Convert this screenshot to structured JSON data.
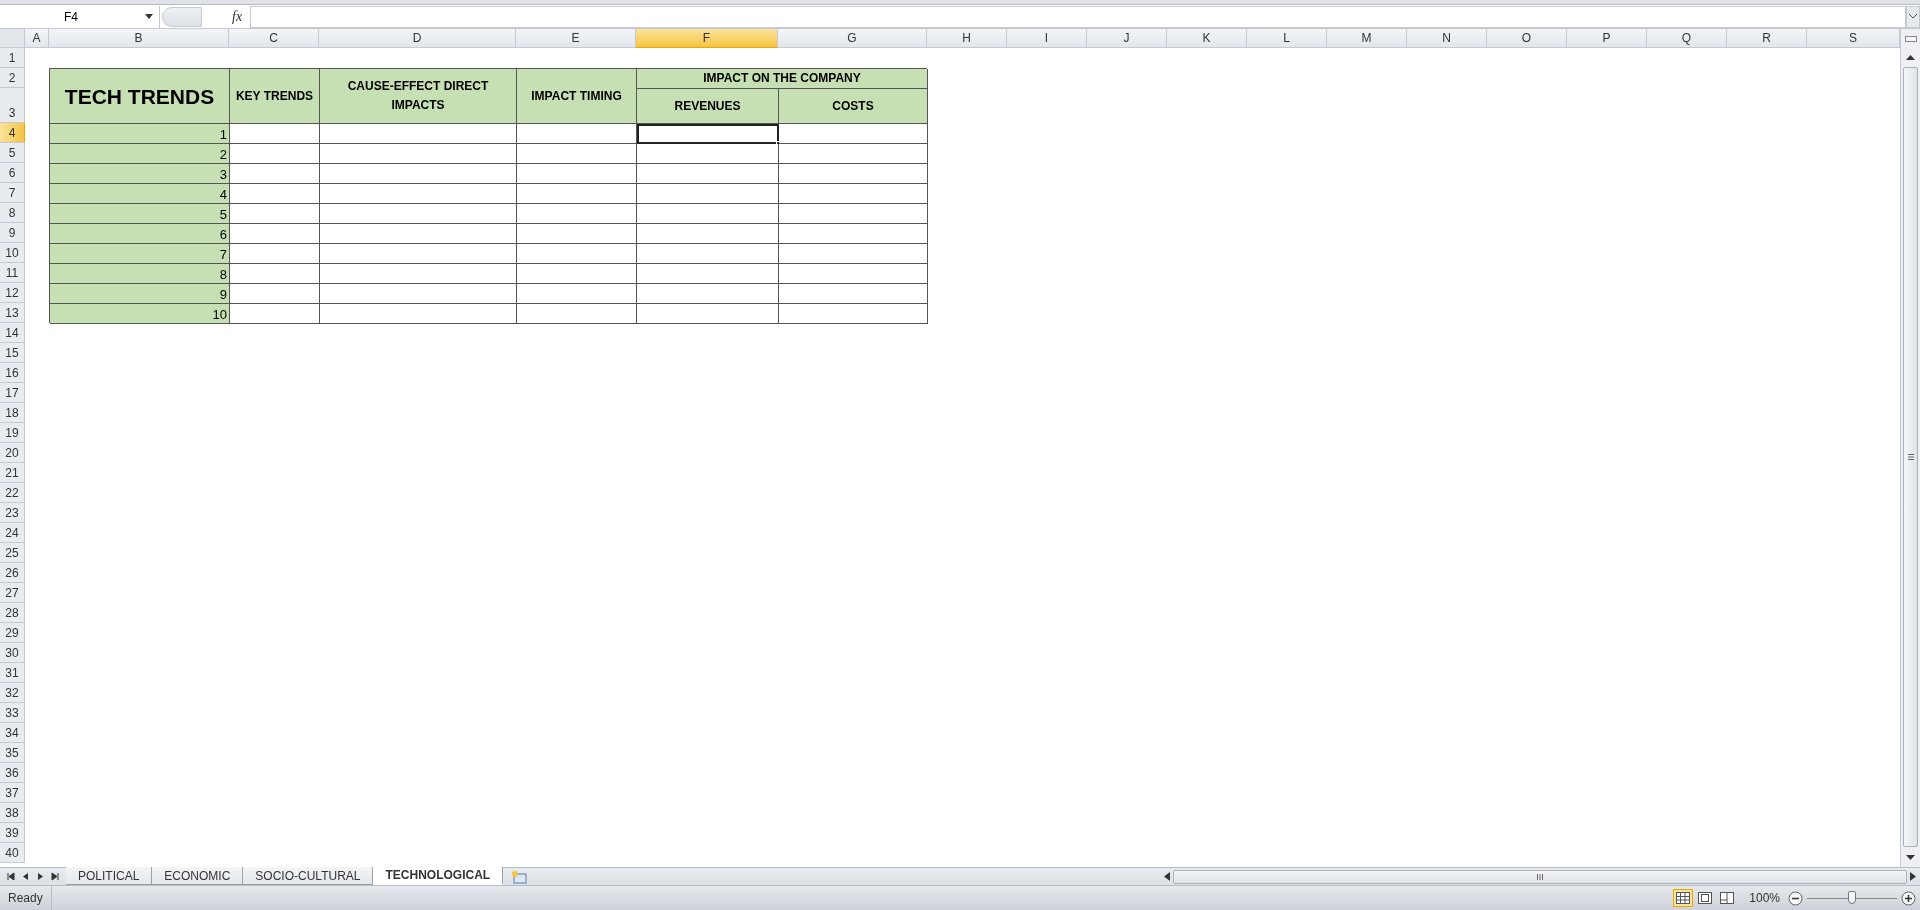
{
  "formula_bar": {
    "name_box": "F4",
    "function_label": "fx"
  },
  "columns": [
    {
      "label": "A",
      "selected": false
    },
    {
      "label": "B",
      "selected": false
    },
    {
      "label": "C",
      "selected": false
    },
    {
      "label": "D",
      "selected": false
    },
    {
      "label": "E",
      "selected": false
    },
    {
      "label": "F",
      "selected": true
    },
    {
      "label": "G",
      "selected": false
    },
    {
      "label": "H",
      "selected": false
    },
    {
      "label": "I",
      "selected": false
    },
    {
      "label": "J",
      "selected": false
    },
    {
      "label": "K",
      "selected": false
    },
    {
      "label": "L",
      "selected": false
    },
    {
      "label": "M",
      "selected": false
    },
    {
      "label": "N",
      "selected": false
    },
    {
      "label": "O",
      "selected": false
    },
    {
      "label": "P",
      "selected": false
    },
    {
      "label": "Q",
      "selected": false
    },
    {
      "label": "R",
      "selected": false
    },
    {
      "label": "S",
      "selected": false
    }
  ],
  "rows": [
    {
      "label": "1",
      "selected": false
    },
    {
      "label": "2",
      "selected": false
    },
    {
      "label": "3",
      "selected": false
    },
    {
      "label": "4",
      "selected": true
    },
    {
      "label": "5",
      "selected": false
    },
    {
      "label": "6",
      "selected": false
    },
    {
      "label": "7",
      "selected": false
    },
    {
      "label": "8",
      "selected": false
    },
    {
      "label": "9",
      "selected": false
    },
    {
      "label": "10",
      "selected": false
    },
    {
      "label": "11",
      "selected": false
    },
    {
      "label": "12",
      "selected": false
    },
    {
      "label": "13",
      "selected": false
    },
    {
      "label": "14",
      "selected": false
    },
    {
      "label": "15",
      "selected": false
    },
    {
      "label": "16",
      "selected": false
    },
    {
      "label": "17",
      "selected": false
    },
    {
      "label": "18",
      "selected": false
    },
    {
      "label": "19",
      "selected": false
    },
    {
      "label": "20",
      "selected": false
    },
    {
      "label": "21",
      "selected": false
    },
    {
      "label": "22",
      "selected": false
    },
    {
      "label": "23",
      "selected": false
    },
    {
      "label": "24",
      "selected": false
    },
    {
      "label": "25",
      "selected": false
    },
    {
      "label": "26",
      "selected": false
    },
    {
      "label": "27",
      "selected": false
    },
    {
      "label": "28",
      "selected": false
    },
    {
      "label": "29",
      "selected": false
    },
    {
      "label": "30",
      "selected": false
    },
    {
      "label": "31",
      "selected": false
    },
    {
      "label": "32",
      "selected": false
    },
    {
      "label": "33",
      "selected": false
    },
    {
      "label": "34",
      "selected": false
    },
    {
      "label": "35",
      "selected": false
    },
    {
      "label": "36",
      "selected": false
    },
    {
      "label": "37",
      "selected": false
    },
    {
      "label": "38",
      "selected": false
    },
    {
      "label": "39",
      "selected": false
    },
    {
      "label": "40",
      "selected": false
    }
  ],
  "table": {
    "title": "TECH TRENDS",
    "headers": [
      "KEY TRENDS",
      "CAUSE-EFFECT DIRECT IMPACTS",
      "IMPACT TIMING"
    ],
    "group_header": "IMPACT ON THE COMPANY",
    "sub_headers": [
      "REVENUES",
      "COSTS"
    ],
    "rows": [
      {
        "number": "1",
        "cells": [
          {
            "selected": false
          },
          {
            "selected": false
          },
          {
            "selected": false
          },
          {
            "selected": true
          },
          {
            "selected": false
          }
        ]
      },
      {
        "number": "2",
        "cells": [
          {
            "selected": false
          },
          {
            "selected": false
          },
          {
            "selected": false
          },
          {
            "selected": false
          },
          {
            "selected": false
          }
        ]
      },
      {
        "number": "3",
        "cells": [
          {
            "selected": false
          },
          {
            "selected": false
          },
          {
            "selected": false
          },
          {
            "selected": false
          },
          {
            "selected": false
          }
        ]
      },
      {
        "number": "4",
        "cells": [
          {
            "selected": false
          },
          {
            "selected": false
          },
          {
            "selected": false
          },
          {
            "selected": false
          },
          {
            "selected": false
          }
        ]
      },
      {
        "number": "5",
        "cells": [
          {
            "selected": false
          },
          {
            "selected": false
          },
          {
            "selected": false
          },
          {
            "selected": false
          },
          {
            "selected": false
          }
        ]
      },
      {
        "number": "6",
        "cells": [
          {
            "selected": false
          },
          {
            "selected": false
          },
          {
            "selected": false
          },
          {
            "selected": false
          },
          {
            "selected": false
          }
        ]
      },
      {
        "number": "7",
        "cells": [
          {
            "selected": false
          },
          {
            "selected": false
          },
          {
            "selected": false
          },
          {
            "selected": false
          },
          {
            "selected": false
          }
        ]
      },
      {
        "number": "8",
        "cells": [
          {
            "selected": false
          },
          {
            "selected": false
          },
          {
            "selected": false
          },
          {
            "selected": false
          },
          {
            "selected": false
          }
        ]
      },
      {
        "number": "9",
        "cells": [
          {
            "selected": false
          },
          {
            "selected": false
          },
          {
            "selected": false
          },
          {
            "selected": false
          },
          {
            "selected": false
          }
        ]
      },
      {
        "number": "10",
        "cells": [
          {
            "selected": false
          },
          {
            "selected": false
          },
          {
            "selected": false
          },
          {
            "selected": false
          },
          {
            "selected": false
          }
        ]
      }
    ]
  },
  "sheet_tabs": [
    {
      "label": "POLITICAL",
      "selected": false
    },
    {
      "label": "ECONOMIC",
      "selected": false
    },
    {
      "label": "SOCIO-CULTURAL",
      "selected": false
    },
    {
      "label": "TECHNOLOGICAL",
      "selected": true
    }
  ],
  "status_bar": {
    "status": "Ready",
    "view_buttons": [
      {
        "kind": "normal",
        "selected": true
      },
      {
        "kind": "page-layout",
        "selected": false
      },
      {
        "kind": "page-break",
        "selected": false
      }
    ],
    "zoom": "100%",
    "zoom_slider": {
      "level": 0.5
    }
  }
}
